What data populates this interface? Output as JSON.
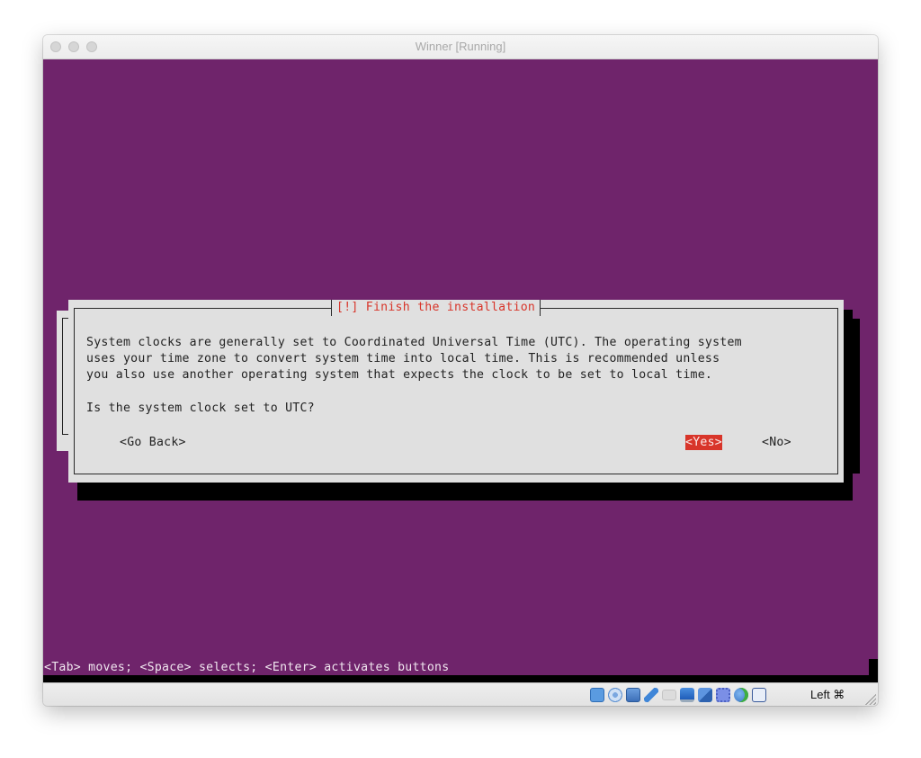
{
  "window": {
    "title": "Winner [Running]"
  },
  "installer": {
    "dialog_title": "[!] Finish the installation",
    "body_lines": [
      "System clocks are generally set to Coordinated Universal Time (UTC). The operating system",
      "uses your time zone to convert system time into local time. This is recommended unless",
      "you also use another operating system that expects the clock to be set to local time."
    ],
    "question": "Is the system clock set to UTC?",
    "buttons": {
      "go_back": "<Go Back>",
      "yes": "<Yes>",
      "no": "<No>"
    },
    "selected_button": "yes",
    "hint": "<Tab> moves; <Space> selects; <Enter> activates buttons"
  },
  "statusbar": {
    "icons": [
      "hard-disk-icon",
      "optical-drive-icon",
      "network-icon",
      "usb-icon",
      "shared-folder-icon",
      "display-icon",
      "video-capture-icon",
      "cpu-icon",
      "mouse-integration-icon",
      "keyboard-capture-icon"
    ],
    "host_key": "Left ⌘"
  },
  "colors": {
    "console_background": "#6f246b",
    "dialog_background": "#e0e0e0",
    "accent_red": "#d8352a"
  }
}
